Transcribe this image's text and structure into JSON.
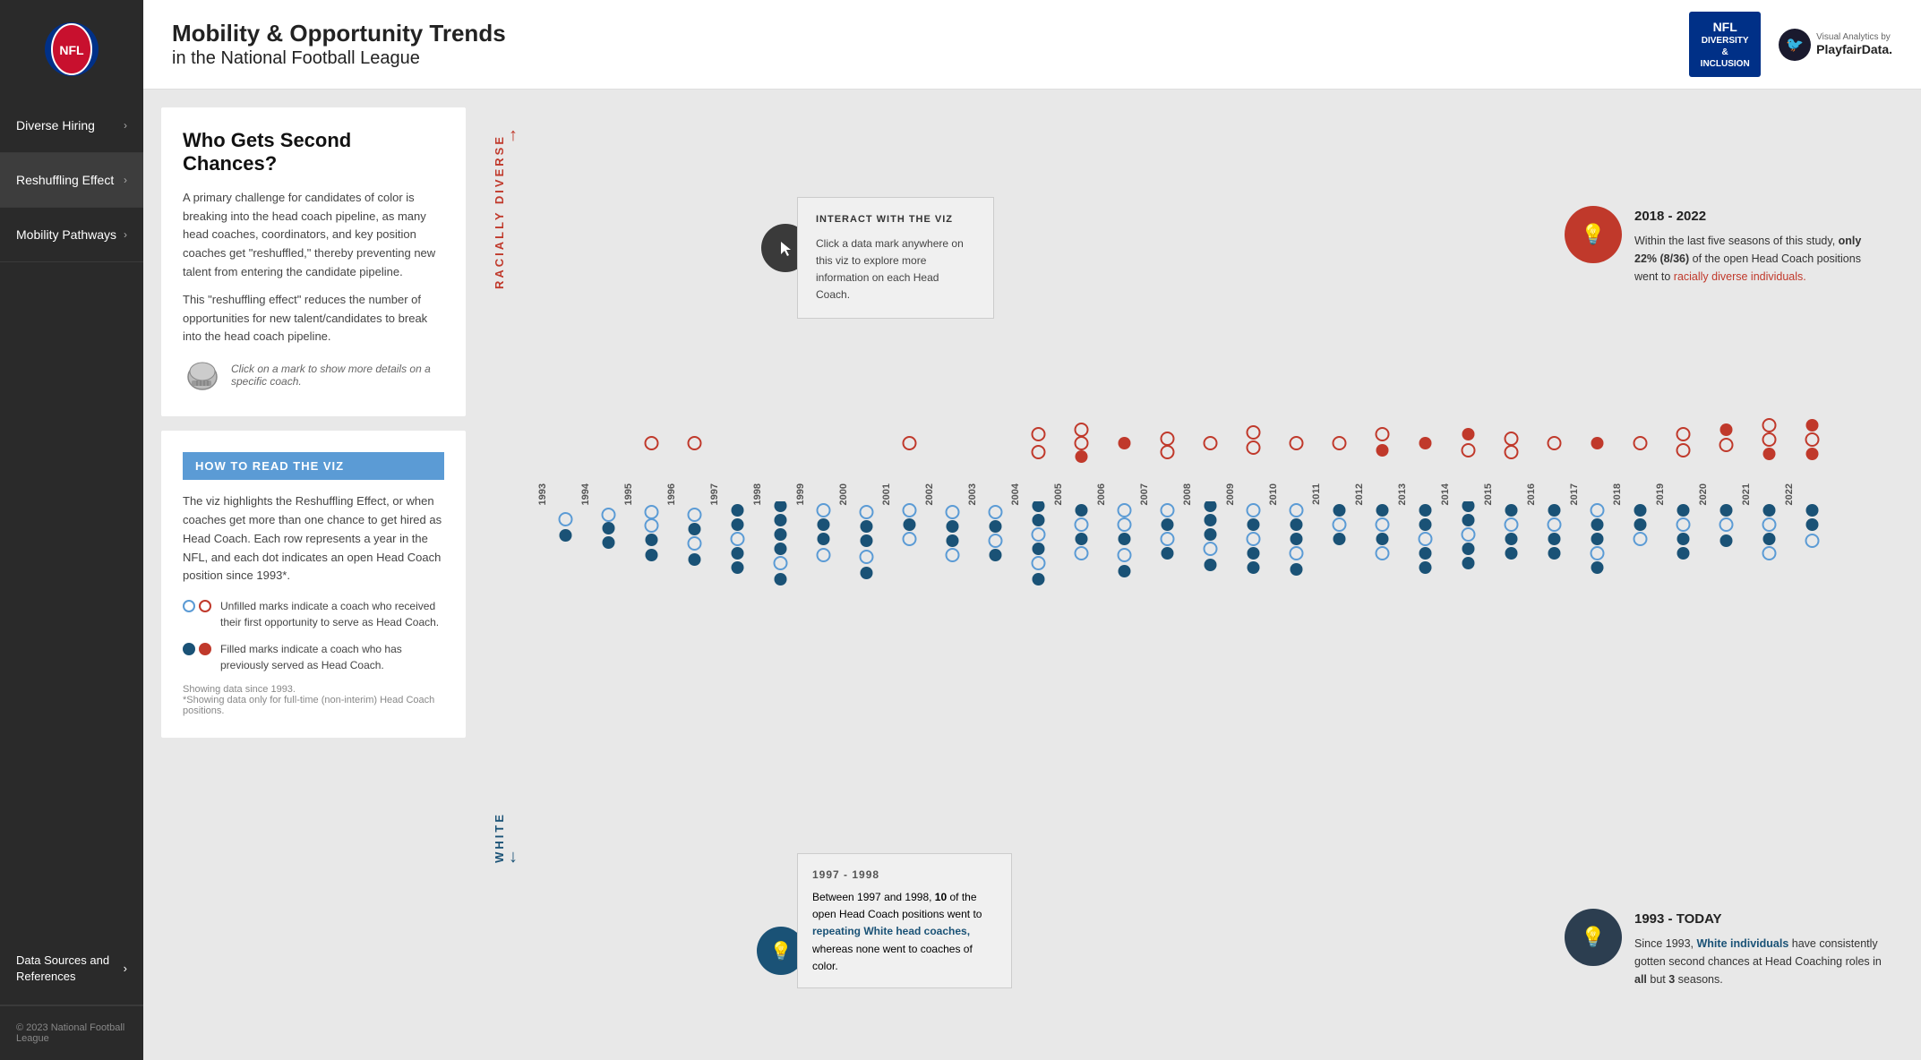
{
  "sidebar": {
    "nav_items": [
      {
        "label": "Diverse Hiring",
        "active": false
      },
      {
        "label": "Reshuffling Effect",
        "active": true
      },
      {
        "label": "Mobility Pathways",
        "active": false
      }
    ],
    "data_sources_label": "Data Sources and References",
    "footer_copyright": "© 2023 National Football League"
  },
  "header": {
    "title_line1": "Mobility & Opportunity Trends",
    "title_line2": "in the National Football League",
    "nfl_di_badge_line1": "NFL",
    "nfl_di_badge_line2": "DIVERSITY",
    "nfl_di_badge_line3": "& INCLUSION",
    "playfair_label": "Visual Analytics by",
    "playfair_brand": "PlayfairData."
  },
  "left_panel": {
    "info_card": {
      "heading": "Who Gets Second Chances?",
      "para1": "A primary challenge for candidates of color is breaking into the head coach pipeline, as many head coaches, coordinators, and key position coaches get \"reshuffled,\" thereby preventing new talent from entering the candidate pipeline.",
      "para2": "This \"reshuffling effect\" reduces the number of opportunities for new talent/candidates to break into the head coach pipeline.",
      "click_hint": "Click on a mark to show more details on a specific coach."
    },
    "how_to_card": {
      "header": "HOW TO READ THE VIZ",
      "para": "The viz highlights the Reshuffling Effect, or when coaches get more than one chance to get hired as Head Coach. Each row represents a year in the NFL, and each dot indicates an open Head Coach position since 1993*.",
      "legend": [
        {
          "type": "open",
          "text": "Unfilled marks indicate a coach who received their first opportunity to serve as Head Coach."
        },
        {
          "type": "filled",
          "text": "Filled marks indicate a coach who has previously served as Head Coach."
        }
      ],
      "showing_note": "Showing data since 1993.",
      "asterisk_note": "*Showing data only for full-time (non-interim) Head Coach positions."
    }
  },
  "viz": {
    "y_label_top": "RACIALLY DIVERSE",
    "y_label_bottom": "WHITE",
    "interact_callout": {
      "title": "INTERACT WITH THE VIZ",
      "text": "Click a data mark anywhere on this viz to explore more information on each Head Coach."
    },
    "callout_2018": {
      "period": "2018 - 2022",
      "text": "Within the last five seasons of this study, only 22% (8/36) of the open Head Coach positions went to racially diverse individuals."
    },
    "callout_1997": {
      "period": "1997 - 1998",
      "text": "Between 1997 and 1998, 10 of the open Head Coach positions went to repeating White head coaches, whereas none went to coaches of color."
    },
    "callout_today": {
      "period": "1993 - TODAY",
      "text": "Since 1993, White individuals have consistently gotten second chances at Head Coaching roles in all but 3 seasons."
    },
    "years": [
      "1993",
      "1994",
      "1995",
      "1996",
      "1997",
      "1998",
      "1999",
      "2000",
      "2001",
      "2002",
      "2003",
      "2004",
      "2005",
      "2006",
      "2007",
      "2008",
      "2009",
      "2010",
      "2011",
      "2012",
      "2013",
      "2014",
      "2015",
      "2016",
      "2017",
      "2018",
      "2019",
      "2020",
      "2021",
      "2022"
    ]
  }
}
